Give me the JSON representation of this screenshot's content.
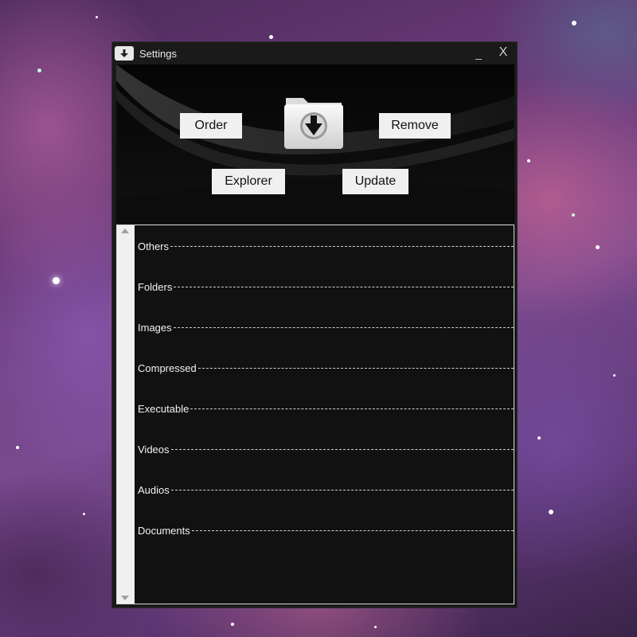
{
  "window": {
    "title": "Settings",
    "minimize_label": "_",
    "close_label": "X"
  },
  "icons": {
    "app": "download-icon",
    "center": "download-folder-icon"
  },
  "buttons": {
    "order": "Order",
    "remove": "Remove",
    "explorer": "Explorer",
    "update": "Update"
  },
  "categories": [
    "Others",
    "Folders",
    "Images",
    "Compressed",
    "Executable",
    "Videos",
    "Audios",
    "Documents"
  ],
  "colors": {
    "window_bg": "#1a1a1a",
    "panel_bg": "#111111",
    "button_bg": "#f0f0f0",
    "text": "#f2f2f2"
  }
}
